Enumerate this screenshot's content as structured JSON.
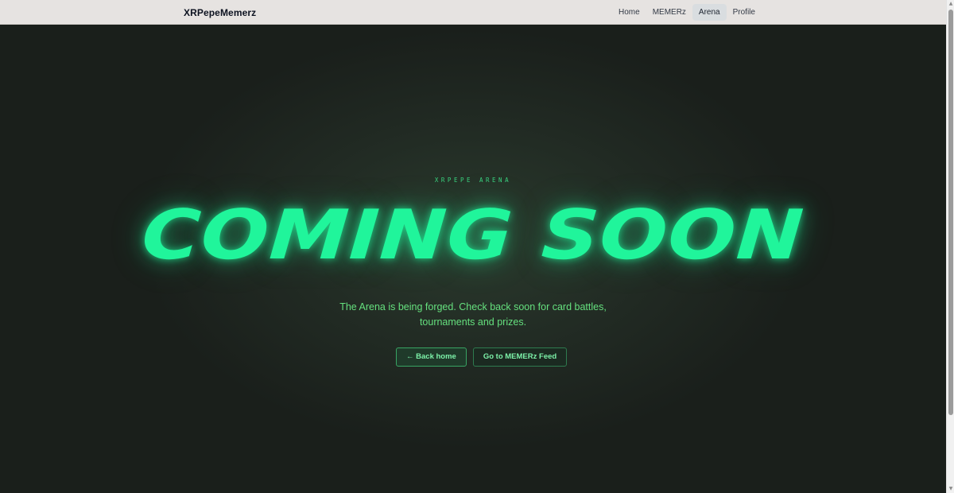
{
  "brand": "XRPepeMemerz",
  "nav": {
    "items": [
      {
        "label": "Home",
        "active": false
      },
      {
        "label": "MEMERz",
        "active": false
      },
      {
        "label": "Arena",
        "active": true
      },
      {
        "label": "Profile",
        "active": false
      }
    ]
  },
  "hero": {
    "eyebrow": "XRPEPE ARENA",
    "headline": "COMING SOON",
    "subtext": "The Arena is being forged. Check back soon for card battles, tournaments and prizes.",
    "buttons": {
      "back": "← Back home",
      "feed": "Go to MEMERz Feed"
    }
  },
  "colors": {
    "accent": "#20f59b",
    "background": "#1a1f1b",
    "navbar": "#e6e3e1",
    "subtext": "#65e07e"
  }
}
